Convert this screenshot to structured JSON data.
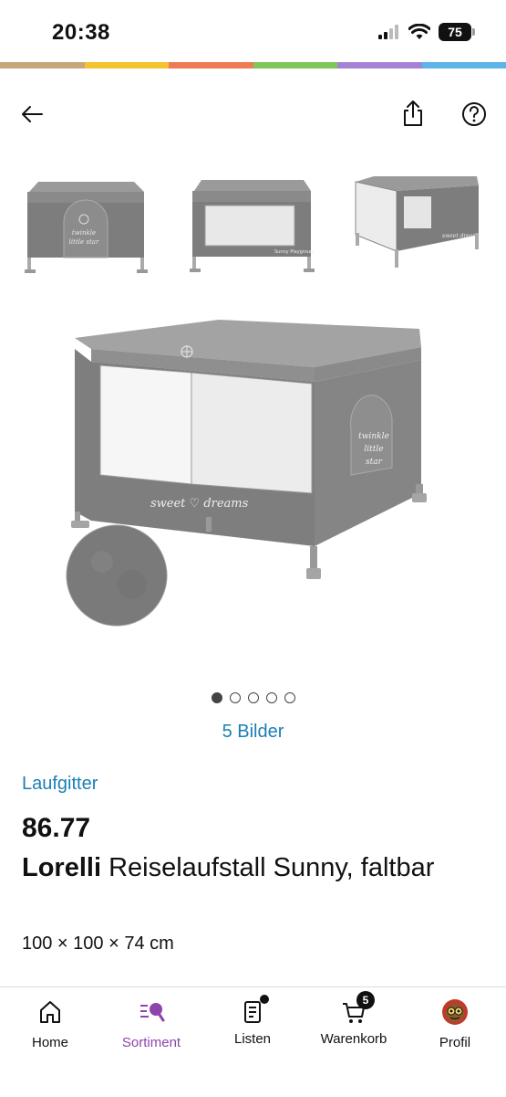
{
  "status_bar": {
    "time": "20:38",
    "battery": "75"
  },
  "brand_strip_colors": [
    "#c9a57a",
    "#f4c430",
    "#ee7a56",
    "#7fc65b",
    "#a682d4",
    "#5db4e6"
  ],
  "top_nav": {
    "back_icon": "arrow-left-icon",
    "share_icon": "share-icon",
    "help_icon": "question-circle-icon"
  },
  "gallery": {
    "thumbnail_count": 3,
    "pagination_total": 5,
    "pagination_active": 0,
    "images_link": "5 Bilder"
  },
  "product": {
    "category": "Laufgitter",
    "price": "86.77",
    "brand": "Lorelli",
    "name": " Reiselaufstall Sunny, faltbar",
    "dimensions": "100 × 100 × 74 cm"
  },
  "bottom_nav": {
    "items": [
      {
        "label": "Home",
        "icon": "home-icon"
      },
      {
        "label": "Sortiment",
        "icon": "catalog-search-icon"
      },
      {
        "label": "Listen",
        "icon": "list-icon"
      },
      {
        "label": "Warenkorb",
        "icon": "cart-icon",
        "badge": "5"
      },
      {
        "label": "Profil",
        "icon": "avatar-icon"
      }
    ],
    "active_color": "#8e44ad"
  }
}
